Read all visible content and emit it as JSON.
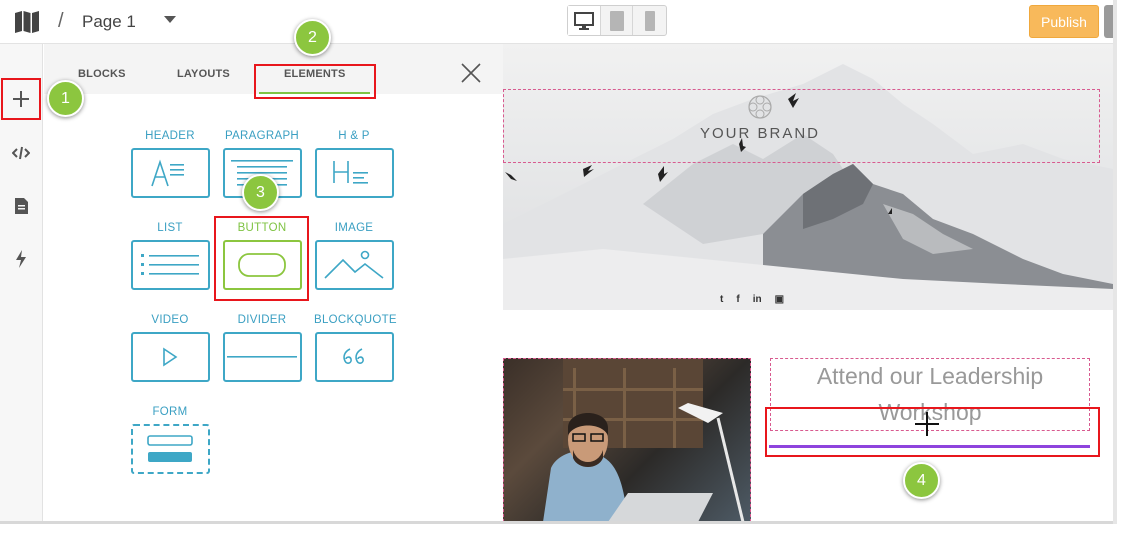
{
  "breadcrumb": {
    "separator": "/",
    "page": "Page 1"
  },
  "toolbar": {
    "publish_label": "Publish"
  },
  "panel": {
    "tabs": [
      {
        "label": "BLOCKS"
      },
      {
        "label": "LAYOUTS"
      },
      {
        "label": "ELEMENTS"
      }
    ],
    "elements": [
      {
        "label": "HEADER"
      },
      {
        "label": "PARAGRAPH"
      },
      {
        "label": "H & P"
      },
      {
        "label": "LIST"
      },
      {
        "label": "BUTTON"
      },
      {
        "label": "IMAGE"
      },
      {
        "label": "VIDEO"
      },
      {
        "label": "DIVIDER"
      },
      {
        "label": "BLOCKQUOTE"
      },
      {
        "label": "FORM"
      }
    ]
  },
  "callouts": [
    "1",
    "2",
    "3",
    "4"
  ],
  "canvas": {
    "brand": "YOUR BRAND",
    "social": [
      "t",
      "f",
      "in",
      "▣"
    ],
    "headline": "Attend our Leadership Workshop"
  },
  "colors": {
    "accent_teal": "#3ea7c6",
    "accent_green": "#8cc63f",
    "publish": "#f8b95b",
    "highlight_red": "#e8161c",
    "divider_purple": "#8e44dd"
  }
}
